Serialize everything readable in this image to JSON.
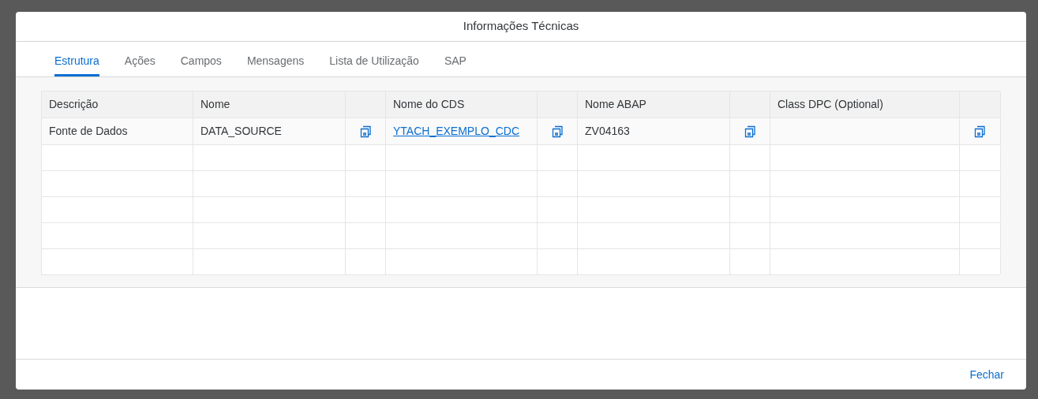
{
  "dialog": {
    "title": "Informações Técnicas"
  },
  "tabs": [
    {
      "label": "Estrutura",
      "selected": true
    },
    {
      "label": "Ações",
      "selected": false
    },
    {
      "label": "Campos",
      "selected": false
    },
    {
      "label": "Mensagens",
      "selected": false
    },
    {
      "label": "Lista de Utilização",
      "selected": false
    },
    {
      "label": "SAP",
      "selected": false
    }
  ],
  "table": {
    "columns": [
      {
        "kind": "text",
        "label": "Descrição"
      },
      {
        "kind": "text",
        "label": "Nome"
      },
      {
        "kind": "icon"
      },
      {
        "kind": "text",
        "label": "Nome do CDS"
      },
      {
        "kind": "icon"
      },
      {
        "kind": "text",
        "label": "Nome ABAP"
      },
      {
        "kind": "icon"
      },
      {
        "kind": "text",
        "label": "Class DPC (Optional)"
      },
      {
        "kind": "icon"
      }
    ],
    "rows": [
      {
        "cells": [
          {
            "kind": "text",
            "text": "Fonte de Dados"
          },
          {
            "kind": "text",
            "text": "DATA_SOURCE"
          },
          {
            "kind": "copy"
          },
          {
            "kind": "link",
            "text": "YTACH_EXEMPLO_CDC"
          },
          {
            "kind": "copy"
          },
          {
            "kind": "text",
            "text": "ZV04163"
          },
          {
            "kind": "copy"
          },
          {
            "kind": "empty"
          },
          {
            "kind": "copy"
          }
        ]
      }
    ]
  },
  "footer": {
    "buttons": [
      "Fechar"
    ]
  }
}
